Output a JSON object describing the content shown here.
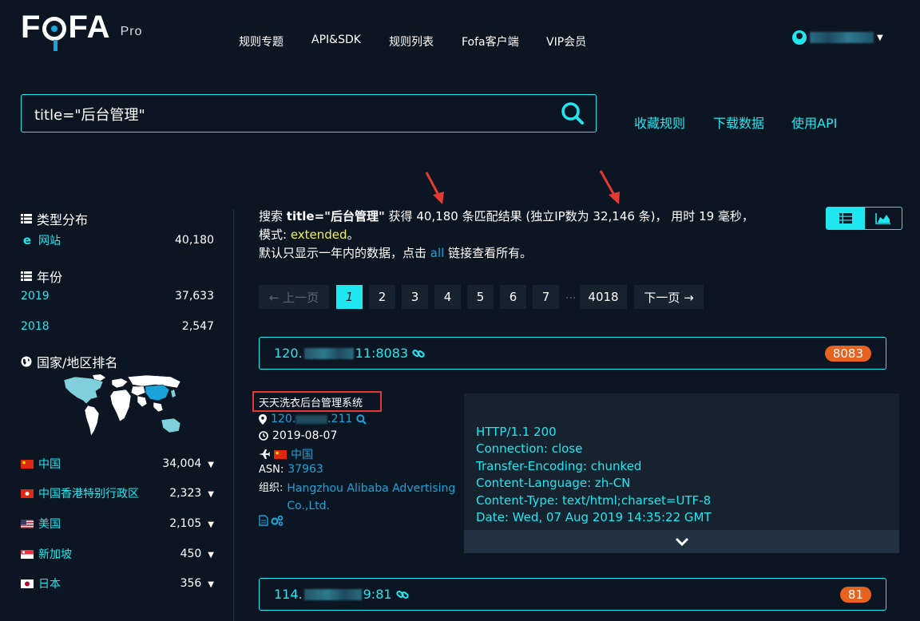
{
  "brand": {
    "name_pre": "F",
    "name_post": "FA",
    "suffix": "Pro"
  },
  "nav": {
    "items": [
      "规则专题",
      "API&SDK",
      "规则列表",
      "Fofa客户端",
      "VIP会员"
    ]
  },
  "search": {
    "query": "title=\"后台管理\""
  },
  "actions": {
    "save_rule": "收藏规则",
    "download": "下载数据",
    "use_api": "使用API"
  },
  "sidebar": {
    "type_heading": "类型分布",
    "types": [
      {
        "label": "网站",
        "count": "40,180"
      }
    ],
    "year_heading": "年份",
    "years": [
      {
        "label": "2019",
        "count": "37,633"
      },
      {
        "label": "2018",
        "count": "2,547"
      }
    ],
    "country_heading": "国家/地区排名",
    "countries": [
      {
        "label": "中国",
        "count": "34,004"
      },
      {
        "label": "中国香港特别行政区",
        "count": "2,323"
      },
      {
        "label": "美国",
        "count": "2,105"
      },
      {
        "label": "新加坡",
        "count": "450"
      },
      {
        "label": "日本",
        "count": "356"
      }
    ]
  },
  "summary": {
    "p1": "搜索 ",
    "query": "title=\"后台管理\"",
    "p2": " 获得 40,180 条匹配结果 (独立IP数为 32,146 条)， 用时 19 毫秒，模式: ",
    "mode": "extended",
    "p3": "。",
    "p4": "默认只显示一年内的数据，点击 ",
    "all": "all",
    "p5": " 链接查看所有。"
  },
  "pagination": {
    "prev": "← 上一页",
    "pages": [
      "1",
      "2",
      "3",
      "4",
      "5",
      "6",
      "7"
    ],
    "dots": "...",
    "last": "4018",
    "next": "下一页 →"
  },
  "results": [
    {
      "host_prefix": "120.",
      "host_suffix": "11:8083",
      "port": "8083",
      "title": "天天洗衣后台管理系统",
      "ip_prefix": "120.",
      "ip_suffix": ".211",
      "date": "2019-08-07",
      "country": "中国",
      "asn_label": "ASN:",
      "asn": "37963",
      "org_label": "组织:",
      "org": "Hangzhou Alibaba Advertising Co.,Ltd.",
      "http_lines": [
        "HTTP/1.1 200",
        "Connection: close",
        "Transfer-Encoding: chunked",
        "Content-Language: zh-CN",
        "Content-Type: text/html;charset=UTF-8",
        "Date: Wed, 07 Aug 2019 14:35:22 GMT"
      ]
    },
    {
      "host_prefix": "114.",
      "host_suffix": "9:81",
      "port": "81"
    }
  ],
  "colors": {
    "accent": "#1fe7f0",
    "link": "#1aa3d8",
    "port_badge": "#e8621f",
    "highlight": "#e53935",
    "mode": "#f3f34a"
  }
}
